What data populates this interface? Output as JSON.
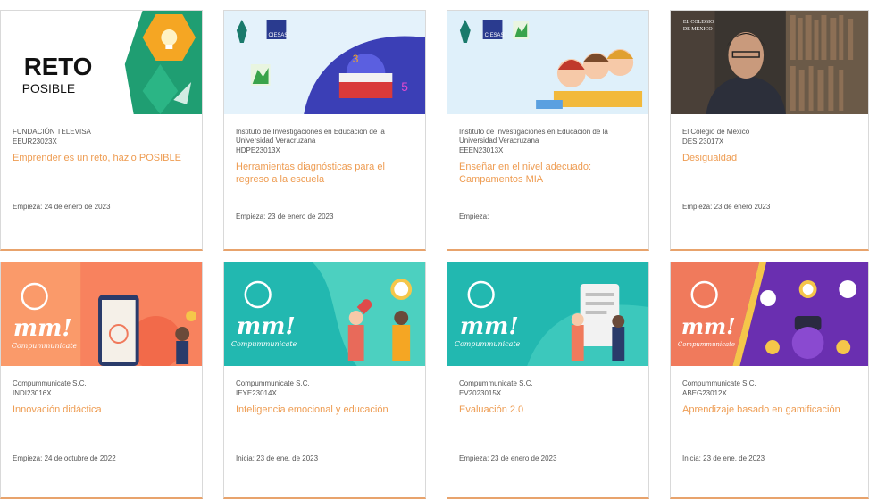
{
  "courses": [
    {
      "org": "FUNDACIÓN TELEVISA",
      "code": "EEUR23023X",
      "title": "Emprender es un reto, hazlo POSIBLE",
      "date": "Empieza: 24 de enero de 2023",
      "thumb_text": [
        "RETO",
        "POSIBLE"
      ]
    },
    {
      "org": "Instituto de Investigaciones en Educación de la Universidad Veracruzana",
      "code": "HDPE23013X",
      "title": "Herramientas diagnósticas para el regreso a la escuela",
      "date": "Empieza: 23 de enero de 2023",
      "thumb_text": [
        "CIESAS"
      ]
    },
    {
      "org": "Instituto de Investigaciones en Educación de la Universidad Veracruzana",
      "code": "EEEN23013X",
      "title": "Enseñar en el nivel adecuado: Campamentos MIA",
      "date": "Empieza:",
      "thumb_text": [
        "CIESAS"
      ]
    },
    {
      "org": "El Colegio de México",
      "code": "DESI23017X",
      "title": "Desigualdad",
      "date": "Empieza: 23 de enero 2023",
      "thumb_text": [
        "EL COLEGIO",
        "DE MÉXICO"
      ]
    },
    {
      "org": "Compummunicate S.C.",
      "code": "INDI23016X",
      "title": "Innovación didáctica",
      "date": "Empieza: 24 de octubre de 2022",
      "thumb_text": [
        "mm!",
        "Compummunicate"
      ]
    },
    {
      "org": "Compummunicate S.C.",
      "code": "IEYE23014X",
      "title": "Inteligencia emocional y educación",
      "date": "Inicia: 23 de ene. de 2023",
      "thumb_text": [
        "mm!",
        "Compummunicate"
      ]
    },
    {
      "org": "Compummunicate S.C.",
      "code": "EV2023015X",
      "title": "Evaluación 2.0",
      "date": "Empieza: 23 de enero de 2023",
      "thumb_text": [
        "mm!",
        "Compummunicate"
      ]
    },
    {
      "org": "Compummunicate S.C.",
      "code": "ABEG23012X",
      "title": "Aprendizaje basado en gamificación",
      "date": "Inicia: 23 de ene. de 2023",
      "thumb_text": [
        "mm!",
        "Compummunicate"
      ]
    }
  ],
  "colors": {
    "accent": "#ee9c52",
    "teal": "#22b8b0",
    "coral": "#f07a5c",
    "purple": "#6a2fb0"
  }
}
